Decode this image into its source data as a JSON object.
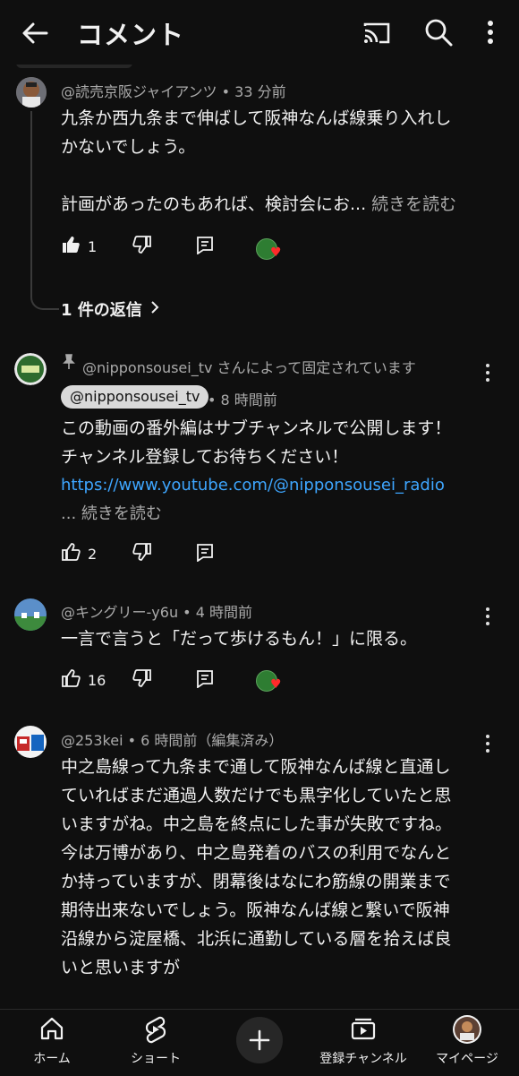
{
  "header": {
    "title": "コメント",
    "icons": [
      "back-arrow-icon",
      "cast-icon",
      "search-icon",
      "more-vert-icon"
    ]
  },
  "comments": [
    {
      "author": "@読売京阪ジャイアンツ",
      "time": "33 分前",
      "text_lines": [
        "九条か西九条まで伸ばして阪神なんば線乗り入れし",
        "かないでしょう。"
      ],
      "text_line2": "計画があったのもあれば、検討会にお...",
      "read_more": "続きを読む",
      "likes": "1",
      "heart": true,
      "replies_label": "1 件の返信"
    },
    {
      "pinned_label": "@nipponsousei_tv さんによって固定されています",
      "author": "@nipponsousei_tv",
      "time": "8 時間前",
      "text_lines": [
        "この動画の番外編はサブチャンネルで公開します！",
        "チャンネル登録してお待ちください！"
      ],
      "link": "https://www.youtube.com/@nipponsousei_radio",
      "read_more": "... 続きを読む",
      "likes": "2"
    },
    {
      "author": "@キングリー-y6u",
      "time": "4 時間前",
      "text": "一言で言うと「だって歩けるもん！」に限る。",
      "likes": "16",
      "heart": true
    },
    {
      "author": "@253kei",
      "time": "6 時間前（編集済み）",
      "text_lines": [
        "中之島線って九条まで通して阪神なんば線と直通し",
        "ていればまだ通過人数だけでも黒字化していたと思",
        "いますがね。中之島を終点にした事が失敗ですね。",
        "今は万博があり、中之島発着のバスの利用でなんと",
        "か持っていますが、閉幕後はなにわ筋線の開業まで",
        "期待出来ないでしょう。阪神なんば線と繋いで阪神",
        "沿線から淀屋橋、北浜に通勤している層を拾えば良",
        "いと思いますが"
      ]
    }
  ],
  "bottom_nav": {
    "home": "ホーム",
    "shorts": "ショート",
    "subscriptions": "登録チャンネル",
    "mypage": "マイページ"
  },
  "colors": {
    "background": "#0f0f0f",
    "link": "#3ea6ff",
    "heart": "#ff2a2a",
    "secondary_text": "#aaaaaa"
  }
}
